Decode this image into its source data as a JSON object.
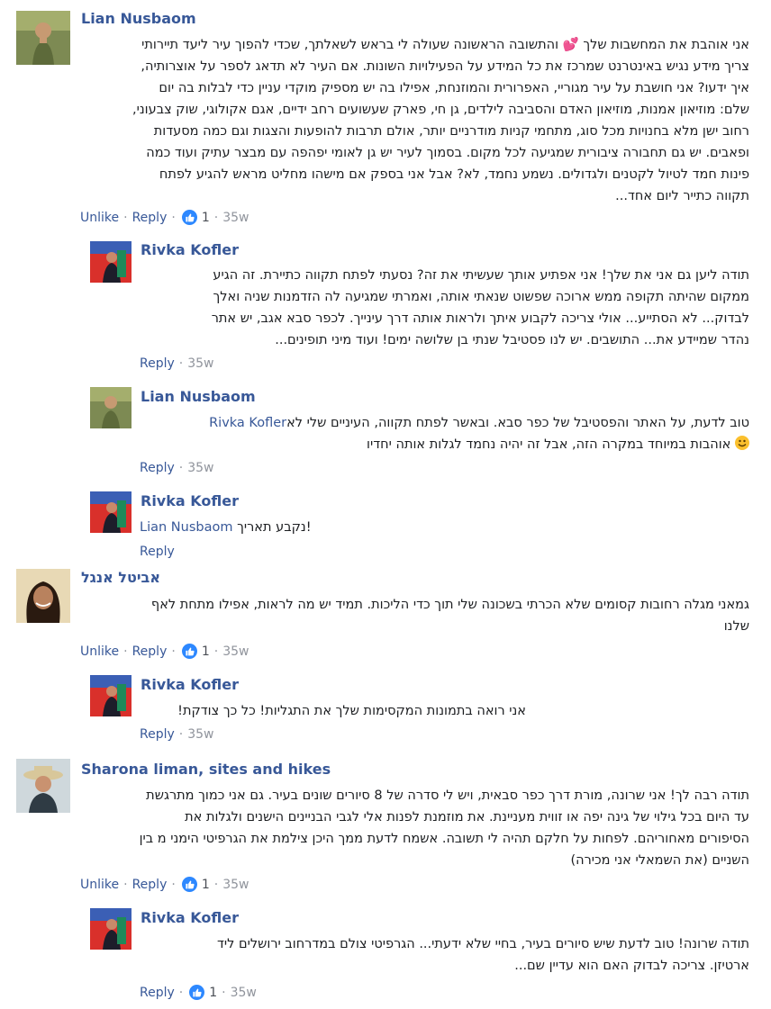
{
  "comments": [
    {
      "name": "Lian Nusbaom",
      "lines": [
        "אני אוהבת את המחשבות שלך 💕 והתשובה הראשונה שעולה לי בראש לשאלתך, שכדי להפוך עיר ליעד תיירותי",
        "צריך מידע נגיש באינטרנט שמרכז את כל המידע על הפעילויות השונות. אם העיר לא תדאג לספר על אוצרותיה,",
        "איך ידעו? אני חושבת על עיר מגוריי, האפרורית והמוזנחת, אפילו בה יש מספיק מוקדי עניין כדי לבלות בה יום",
        "שלם: מוזיאון אמנות, מוזיאון האדם והסביבה לילדים, גן חי, פארק שעשועים רחב ידיים, אגם אקולוגי, שוק צבעוני,",
        "רחוב ישן מלא בחנויות מכל סוג, מתחמי קניות מודרניים יותר, אולם תרבות להופעות והצגות וגם כמה מסעדות",
        "ופאבים. יש גם תחבורה ציבורית שמגיעה לכל מקום. בסמוך לעיר יש גן לאומי יפהפה עם מבצר עתיק ועוד כמה",
        "פינות חמד לטיול לקטנים ולגדולים. נשמע נחמד, לא? אבל אני בספק אם מישהו מחליט מראש להגיע לפתח",
        "תקווה כתייר ליום אחד..."
      ],
      "unlike": "Unlike",
      "reply": "Reply",
      "likes": "1",
      "time": "35w"
    },
    {
      "name": "Rivka Kofler",
      "lines": [
        "תודה ליען גם אני את שלך! אני אפתיע אותך שעשיתי את זה? נסעתי לפתח תקווה כתיירת. זה הגיע",
        "ממקום שהיתה תקופה ממש ארוכה שפשוט שנאתי אותה, ואמרתי שמגיעה לה הזדמנות שניה ואלך",
        "לבדוק... לא הסתייע... אולי צריכה לקבוע איתך ולראות אותה דרך עינייך. לכפר סבא אגב, יש אתר",
        "נהדר שמיידע את... התושבים. יש לנו פסטיבל שנתי בן שלושה ימים! ועוד מיני תופינים..."
      ],
      "reply": "Reply",
      "time": "35w"
    },
    {
      "name": "Lian Nusbaom",
      "mention": "Rivka Kofler",
      "line1_rest": " טוב לדעת, על האתר והפסטיבל של כפר סבא. ובאשר לפתח תקווה, העיניים שלי לא",
      "line2": "אוהבות במיוחד במקרה הזה, אבל זה יהיה נחמד לגלות אותה יחדיו",
      "reply": "Reply",
      "time": "35w"
    },
    {
      "name": "Rivka Kofler",
      "mention": "Lian Nusbaom",
      "line1_rest": " נקבע תאריך!",
      "reply": "Reply"
    },
    {
      "name": "אביטל אנגל",
      "lines": [
        "גמאני מגלה רחובות קסומים שלא הכרתי בשכונה שלי תוך כדי הליכות. תמיד יש מה לראות, אפילו מתחת לאף",
        "שלנו"
      ],
      "unlike": "Unlike",
      "reply": "Reply",
      "likes": "1",
      "time": "35w"
    },
    {
      "name": "Rivka Kofler",
      "lines": [
        "אני רואה בתמונות המקסימות שלך את התגליות! כל כך צודקת!"
      ],
      "reply": "Reply",
      "time": "35w"
    },
    {
      "name": "Sharona liman, sites and hikes",
      "lines": [
        "תודה רבה לך! אני שרונה, מורת דרך כפר סבאית, ויש לי סדרה של 8 סיורים שונים בעיר. גם אני כמוך מתרגשת",
        "עד היום בכל גילוי של גינה יפה או זווית מעניינת. את מוזמנת לפנות אלי לגבי הבניינים הישנים ולגלות את",
        "הסיפורים מאחוריהם. לפחות על חלקם תהיה לי תשובה. אשמח לדעת ממך היכן צילמת את הגרפיטי הימני מ בין",
        "השניים (את השמאלי אני מכירה)"
      ],
      "unlike": "Unlike",
      "reply": "Reply",
      "likes": "1",
      "time": "35w"
    },
    {
      "name": "Rivka Kofler",
      "lines": [
        "תודה שרונה! טוב לדעת שיש סיורים בעיר, בחיי שלא ידעתי... הגרפיטי צולם במדרחוב ירושלים ליד",
        "ארטיזן. צריכה לבדוק האם הוא עדיין שם..."
      ],
      "reply": "Reply",
      "likes": "1",
      "time": "35w"
    }
  ],
  "colors": {
    "link": "#385898",
    "text": "#1c1e21",
    "meta": "#90949c",
    "like_blue": "#2d88ff"
  },
  "icons": [
    "like-thumb-icon",
    "smile-emoji-icon",
    "heart-emoji-icon"
  ]
}
